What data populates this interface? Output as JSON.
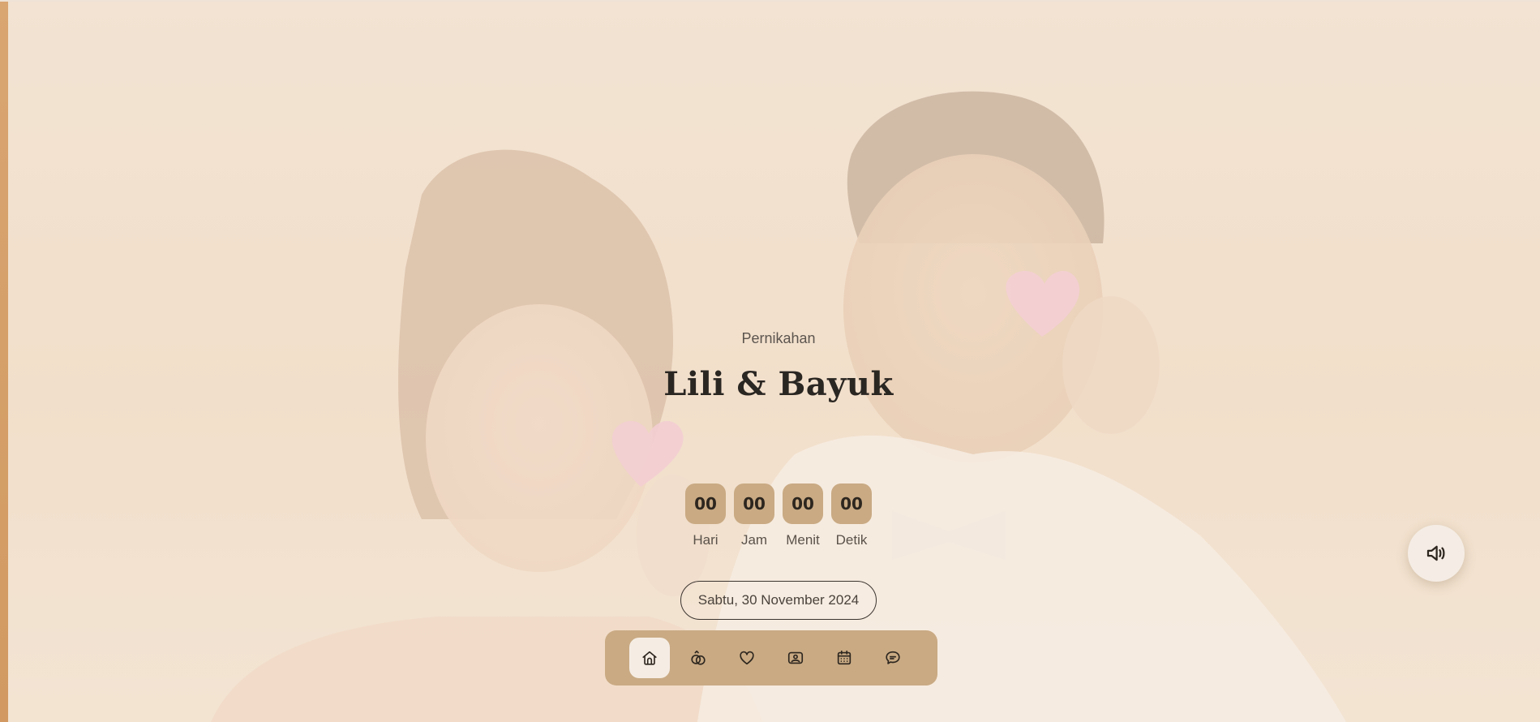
{
  "hero": {
    "subtitle": "Pernikahan",
    "names": "Lili & Bayuk"
  },
  "countdown": [
    {
      "value": "00",
      "label": "Hari"
    },
    {
      "value": "00",
      "label": "Jam"
    },
    {
      "value": "00",
      "label": "Menit"
    },
    {
      "value": "00",
      "label": "Detik"
    }
  ],
  "event": {
    "date": "Sabtu, 30 November 2024"
  },
  "nav": {
    "items": [
      {
        "icon": "home-icon",
        "active": true
      },
      {
        "icon": "rings-icon",
        "active": false
      },
      {
        "icon": "heart-icon",
        "active": false
      },
      {
        "icon": "gallery-icon",
        "active": false
      },
      {
        "icon": "calendar-icon",
        "active": false
      },
      {
        "icon": "chat-icon",
        "active": false
      }
    ]
  },
  "audio": {
    "icon": "speaker-icon"
  },
  "colors": {
    "accent": "#c9aa83",
    "background": "#f2e2d1",
    "text_dark": "#2a2622",
    "sidebar_accent": "#d9a571"
  }
}
